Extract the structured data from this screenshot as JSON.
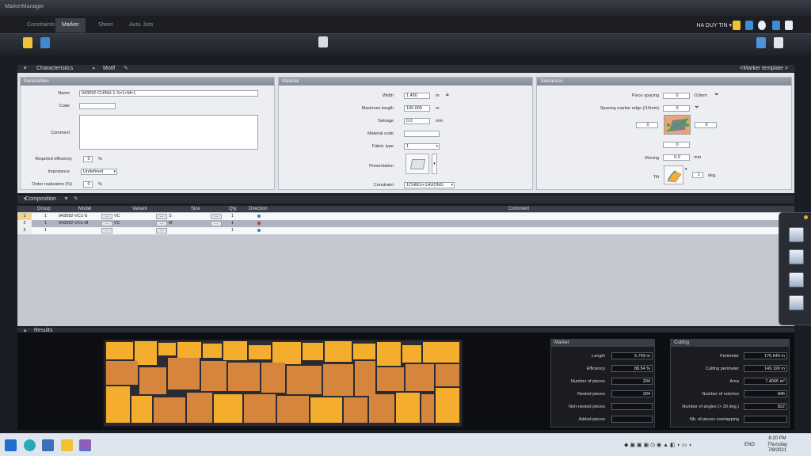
{
  "window": {
    "title": "MarkerManager"
  },
  "tabs": [
    {
      "label": "Constraints",
      "active": false
    },
    {
      "label": "Marker",
      "active": true
    },
    {
      "label": "Sheet",
      "active": false
    },
    {
      "label": "Auto. lists",
      "active": false
    }
  ],
  "user": {
    "name": "HA DUY TIN ▾"
  },
  "sections": {
    "characteristics": "Characteristics",
    "motif": "Motif",
    "template_link": "<Marker template >",
    "composition": "Composition",
    "results": "Results"
  },
  "generalities": {
    "header": "Generalities",
    "name_label": "Name",
    "name_value": "943092-CHINH-1-S=1+M=1",
    "code_label": "Code",
    "code_value": "",
    "comment_label": "Comment",
    "comment_value": "",
    "required_efficiency_label": "Required efficiency",
    "required_efficiency_value": "0",
    "required_efficiency_unit": "%",
    "importance_label": "Importance",
    "importance_value": "Undefined",
    "order_realization_label": "Order realization (%)",
    "order_realization_value": "0",
    "order_realization_unit": "%"
  },
  "material": {
    "header": "Material",
    "width_label": "Width",
    "width_value": "1.450",
    "width_unit": "m",
    "max_length_label": "Maximum length",
    "max_length_value": "100.000",
    "max_length_unit": "m",
    "selvage_label": "Selvage",
    "selvage_value": "0.0",
    "selvage_unit": "mm",
    "material_code_label": "Material code",
    "material_code_value": "",
    "fabric_type_label": "Fabric type",
    "fabric_type_value": "1",
    "presentation_label": "Presentation",
    "constraint_label": "Constraint",
    "constraint_value": "1CHIEU+1HUONG"
  },
  "tolerances": {
    "header": "Tolerances",
    "piece_spacing_label": "Piece spacing",
    "piece_spacing_value": "0",
    "piece_spacing_unit": "/10mm",
    "marker_edge_label": "Spacing marker edge (/10mm)",
    "marker_edge_value": "0",
    "left_value": "0",
    "right_value": "0",
    "bottom_value": "0",
    "moving_label": "Moving",
    "moving_value": "0.0",
    "moving_unit": "mm",
    "tilt_label": "Tilt",
    "tilt_value": "1",
    "tilt_unit": "deg."
  },
  "composition": {
    "columns": [
      "Group",
      "Model",
      "Variant",
      "Size",
      "Qty.",
      "Direction",
      "Comment"
    ],
    "rows": [
      {
        "num": "1",
        "group": "1",
        "model": "943092-VC1-S",
        "variant": "VC",
        "size": "S",
        "qty": "1",
        "direction_color": "#2f7fd0"
      },
      {
        "num": "2",
        "group": "1",
        "model": "943092-VC1-M",
        "variant": "VC",
        "size": "M",
        "qty": "1",
        "direction_color": "#c0392b"
      },
      {
        "num": "3",
        "group": "1",
        "model": "",
        "variant": "",
        "size": "",
        "qty": "1",
        "direction_color": "#2f7fd0"
      }
    ],
    "ellipsis": "..."
  },
  "results": {
    "marker_header": "Marker",
    "cutting_header": "Cutting",
    "marker_stats": [
      {
        "label": "Length",
        "value": "5.769 m"
      },
      {
        "label": "Efficiency",
        "value": "88.54 %"
      },
      {
        "label": "Number of pieces",
        "value": "204"
      },
      {
        "label": "Nested pieces",
        "value": "204"
      },
      {
        "label": "Non-nested pieces",
        "value": ""
      },
      {
        "label": "Added pieces",
        "value": ""
      }
    ],
    "cutting_stats": [
      {
        "label": "Perimeter",
        "value": "175.640 m"
      },
      {
        "label": "Cutting perimeter",
        "value": "149.190 m"
      },
      {
        "label": "Area",
        "value": "7.4065 m²"
      },
      {
        "label": "Number of notches",
        "value": "846"
      },
      {
        "label": "Number of angles (> 30 deg.)",
        "value": "822"
      },
      {
        "label": "Nb. of pieces overlapping",
        "value": ""
      }
    ]
  },
  "taskbar": {
    "language": "ENG",
    "time": "8:20 PM",
    "day": "Thursday",
    "date": "7/8/2021"
  },
  "colors": {
    "piece_yellow": "#f4ad2d",
    "piece_orange": "#d6853c",
    "panel_header": "#8f96a2",
    "accent_blue": "#2f7fd0"
  }
}
